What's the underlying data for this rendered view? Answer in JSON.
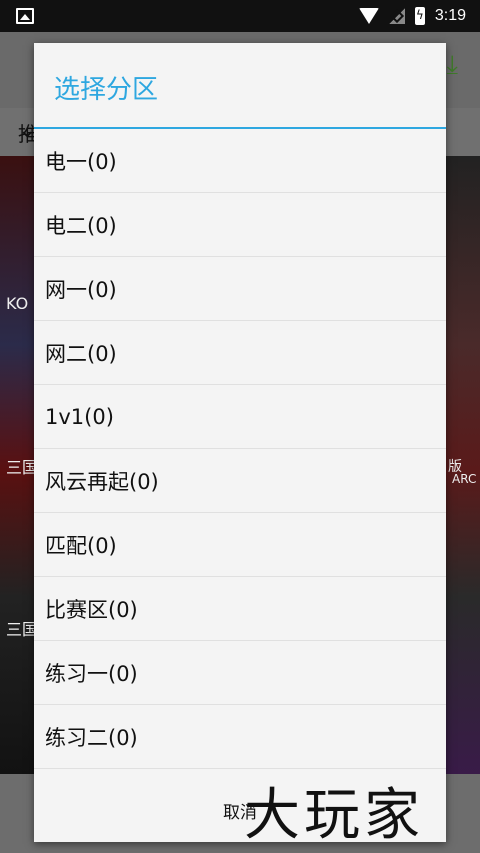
{
  "status_bar": {
    "time": "3:19",
    "icons": [
      "image-icon",
      "wifi-icon",
      "no-signal-icon",
      "battery-charging-icon"
    ]
  },
  "background": {
    "tab_partial": "推",
    "captions": [
      "KO",
      "三国",
      "三国",
      "版",
      "ARC"
    ]
  },
  "dialog": {
    "title": "选择分区",
    "items": [
      {
        "label": "电一(0)"
      },
      {
        "label": "电二(0)"
      },
      {
        "label": "网一(0)"
      },
      {
        "label": "网二(0)"
      },
      {
        "label": "1v1(0)"
      },
      {
        "label": "风云再起(0)"
      },
      {
        "label": "匹配(0)"
      },
      {
        "label": "比赛区(0)"
      },
      {
        "label": "练习一(0)"
      },
      {
        "label": "练习二(0)"
      }
    ],
    "cancel_label": "取消"
  },
  "watermark": "大玩家",
  "colors": {
    "accent": "#2ea7e0",
    "dialog_bg": "#f4f4f4",
    "divider": "#e0e0e0"
  }
}
